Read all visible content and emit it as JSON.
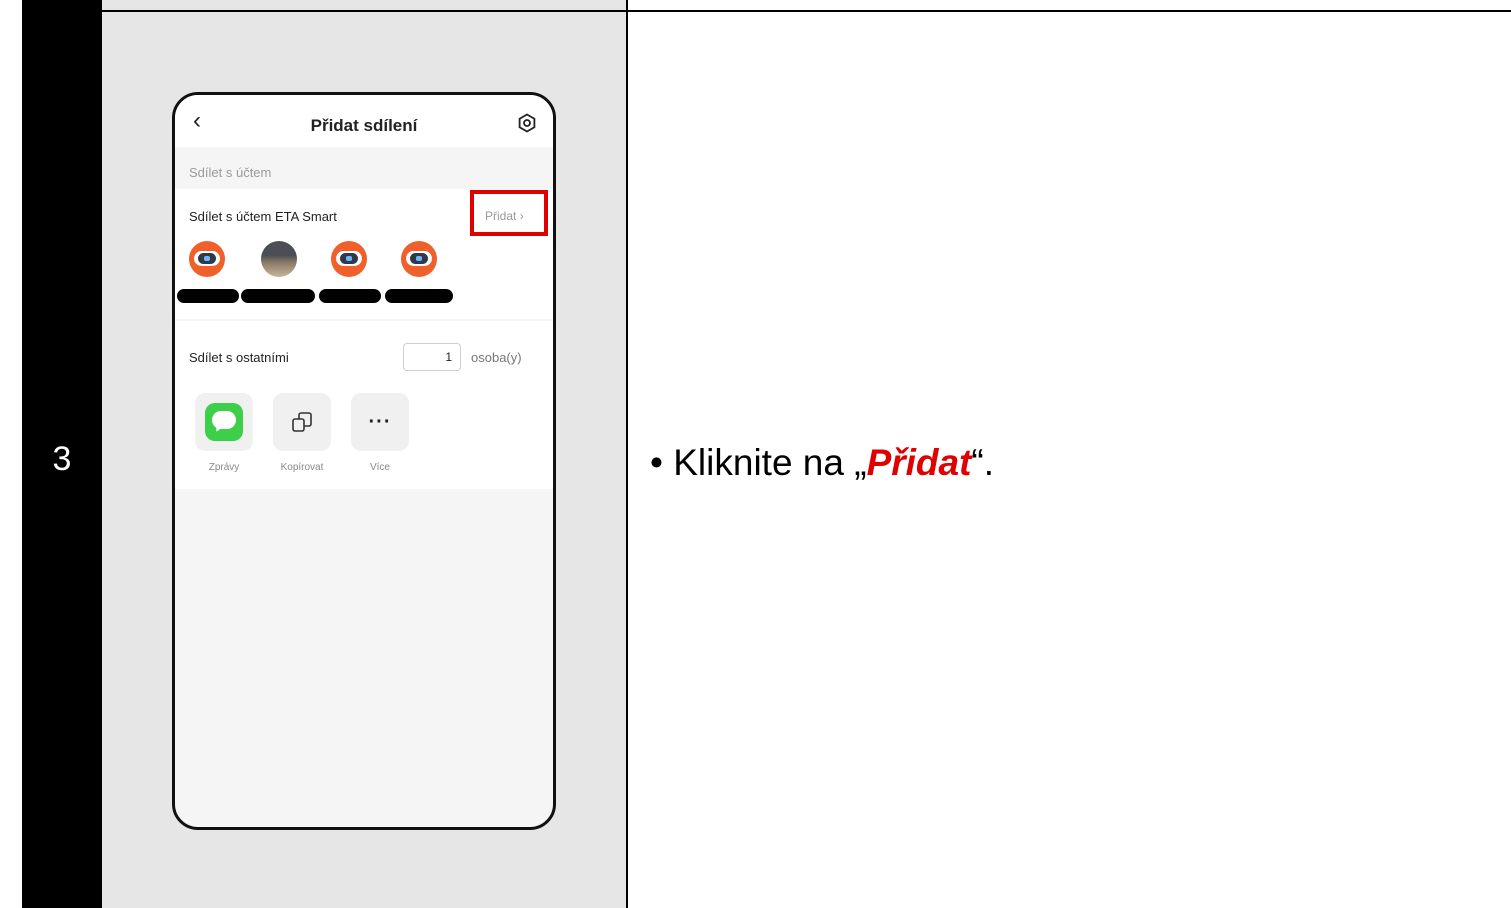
{
  "step": {
    "number": "3"
  },
  "phone": {
    "title": "Přidat sdílení",
    "section_label": "Sdílet s účtem",
    "share_with_account_label": "Sdílet s účtem ETA Smart",
    "add_label": "Přidat",
    "share_with_others_label": "Sdílet s ostatními",
    "person_count": "1",
    "person_unit": "osoba(y)",
    "share_options": [
      {
        "label": "Zprávy",
        "icon": "message-icon"
      },
      {
        "label": "Kopírovat",
        "icon": "copy-icon"
      },
      {
        "label": "Více",
        "icon": "more-icon"
      }
    ]
  },
  "instruction": {
    "bullet": "•",
    "prefix": "Kliknite na „",
    "emphasis": "Přidat",
    "suffix": "“."
  },
  "colors": {
    "highlight": "#e00000",
    "accent_bot": "#f0602a",
    "message_green": "#3ecf4a"
  }
}
